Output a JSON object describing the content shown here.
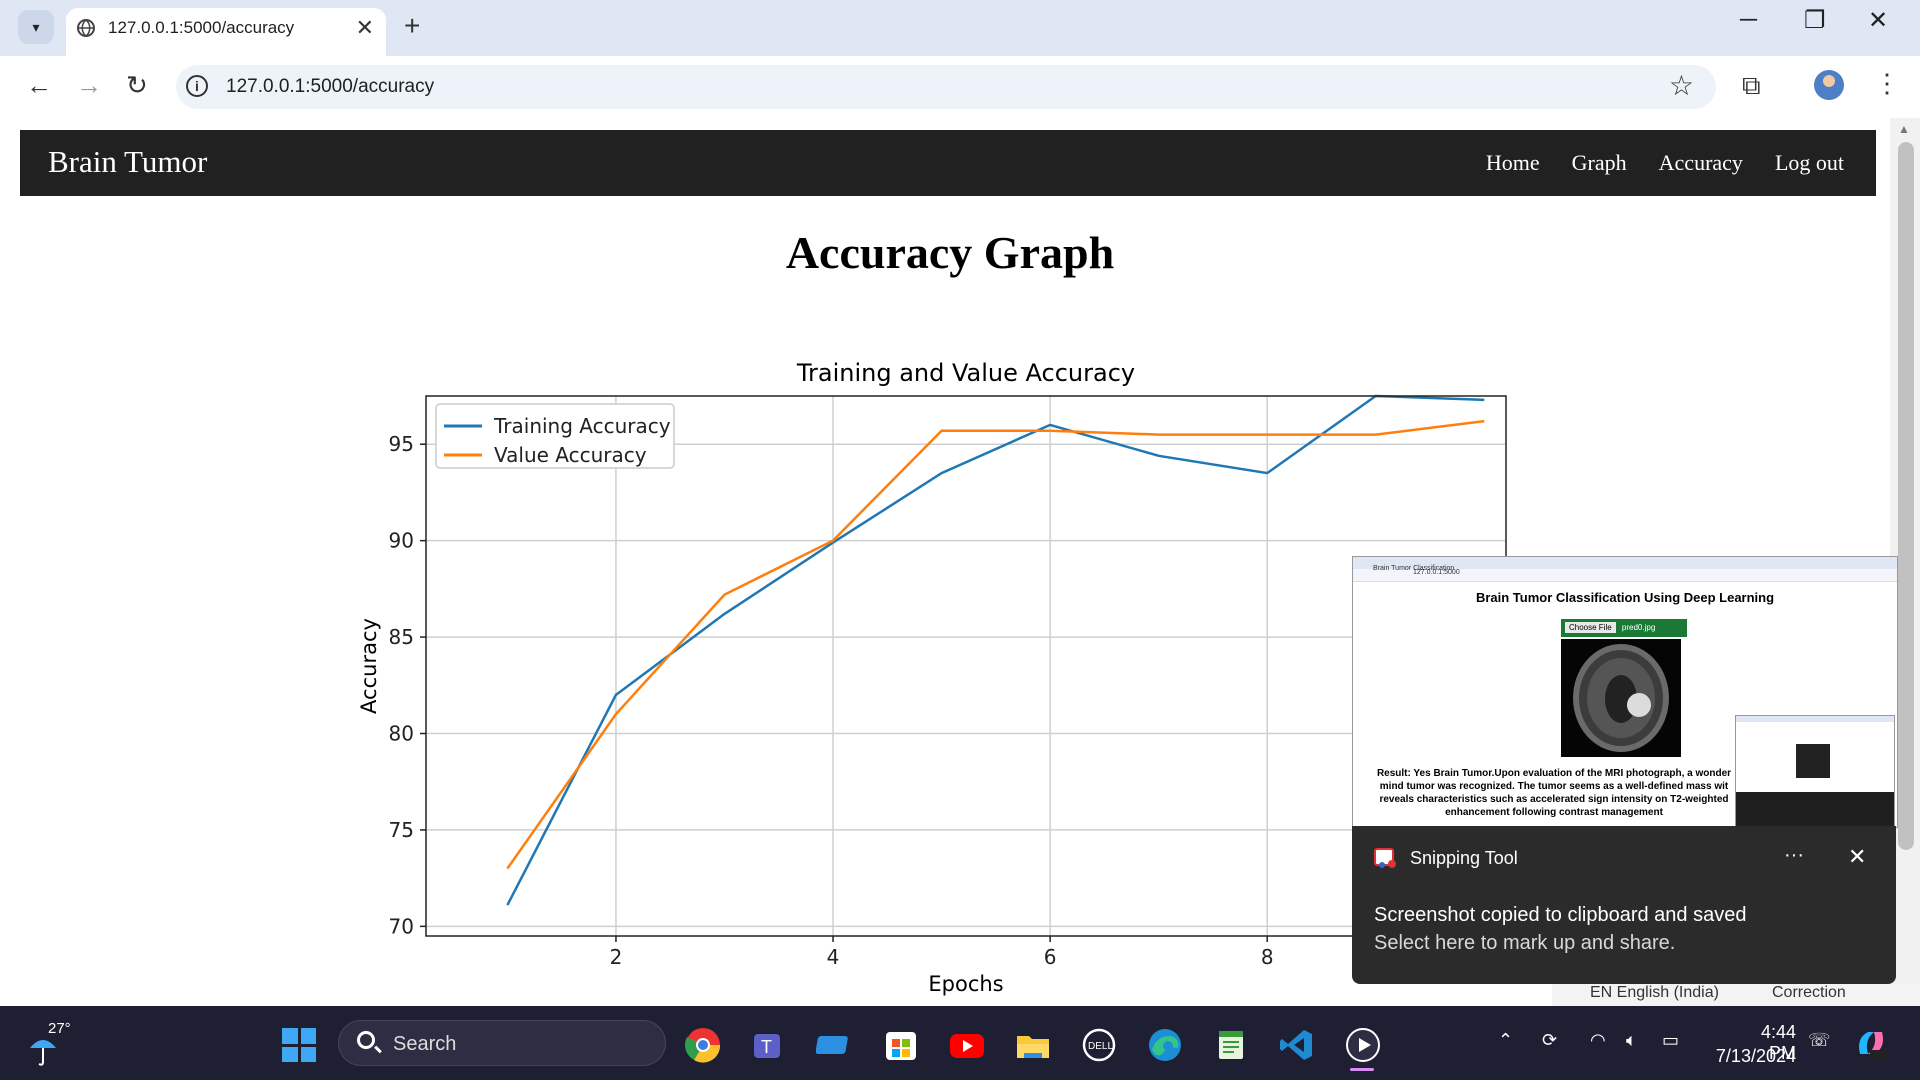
{
  "browser": {
    "tab_title": "127.0.0.1:5000/accuracy",
    "url": "127.0.0.1:5000/accuracy"
  },
  "site": {
    "brand": "Brain Tumor",
    "nav": [
      "Home",
      "Graph",
      "Accuracy",
      "Log out"
    ],
    "page_title": "Accuracy Graph"
  },
  "chart_data": {
    "type": "line",
    "title": "Training and Value Accuracy",
    "xlabel": "Epochs",
    "ylabel": "Accuracy",
    "x": [
      1,
      2,
      3,
      4,
      5,
      6,
      7,
      8,
      9,
      10
    ],
    "xlim": [
      0.25,
      10.2
    ],
    "ylim": [
      69.5,
      97.5
    ],
    "xticks": [
      2,
      4,
      6,
      8
    ],
    "yticks": [
      70,
      75,
      80,
      85,
      90,
      95
    ],
    "grid": true,
    "legend_position": "upper-left",
    "series": [
      {
        "name": "Training Accuracy",
        "color": "#1f77b4",
        "values": [
          71.1,
          82.0,
          86.2,
          89.9,
          93.5,
          96.0,
          94.4,
          93.5,
          97.5,
          97.3
        ]
      },
      {
        "name": "Value Accuracy",
        "color": "#ff7f0e",
        "values": [
          73.0,
          81.0,
          87.2,
          90.0,
          95.7,
          95.7,
          95.5,
          95.5,
          95.5,
          96.2
        ]
      }
    ]
  },
  "preview": {
    "heading": "Brain Tumor Classification Using Deep Learning",
    "file_button": "Choose File",
    "file_name": "pred0.jpg",
    "result_lines": [
      "Result: Yes Brain Tumor.Upon evaluation of the MRI photograph, a wonder",
      "mind tumor was recognized. The tumor seems as a well-defined mass wit",
      "reveals characteristics such as accelerated sign intensity on T2-weighted",
      "enhancement following contrast management"
    ]
  },
  "toast": {
    "app_name": "Snipping Tool",
    "line1": "Screenshot copied to clipboard and saved",
    "line2": "Select here to mark up and share."
  },
  "langbar": {
    "language": "EN English (India)",
    "correction": "Correction"
  },
  "taskbar": {
    "temperature": "27°",
    "search_placeholder": "Search",
    "time": "4:44 PM",
    "date": "7/13/2024",
    "apps": [
      "chrome-icon",
      "teams-icon",
      "app-icon",
      "store-icon",
      "youtube-icon",
      "file-explorer-icon",
      "dell-icon",
      "edge-icon",
      "notepad-icon",
      "vscode-icon",
      "media-player-icon"
    ]
  }
}
